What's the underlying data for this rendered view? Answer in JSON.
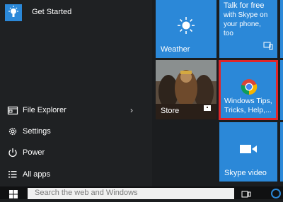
{
  "menu": {
    "get_started": "Get Started",
    "file_explorer": "File Explorer",
    "settings": "Settings",
    "power": "Power",
    "all_apps": "All apps"
  },
  "tiles": {
    "weather": "Weather",
    "skype_title": "Talk for free",
    "skype_line1": "with Skype on",
    "skype_line2": "your phone,",
    "skype_line3": "too",
    "store": "Store",
    "chrome_line1": "Windows Tips,",
    "chrome_line2": "Tricks, Help,...",
    "skype_video": "Skype video"
  },
  "taskbar": {
    "search_placeholder": "Search the web and Windows"
  },
  "colors": {
    "tile_blue": "#2b88d8",
    "highlight_red": "#e0262a",
    "menu_bg": "#1f2123"
  }
}
